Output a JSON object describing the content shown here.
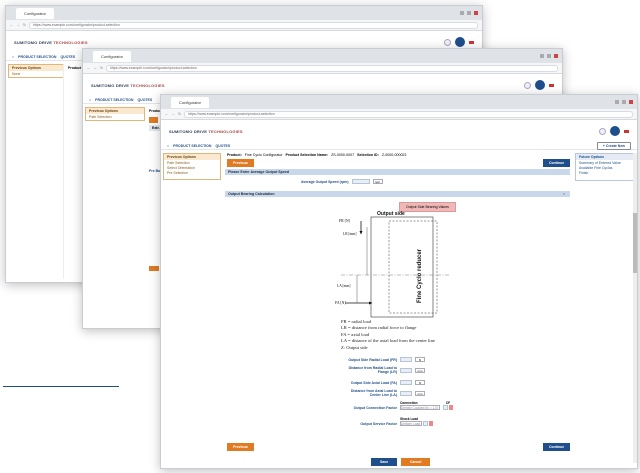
{
  "browser": {
    "tab_label": "Configurator",
    "url": "https://www.example.com/configurator/product-selection"
  },
  "brand": {
    "logo_text": "SUMITOMO DRIVE",
    "logo_suffix": "TECHNOLOGIES"
  },
  "nav": {
    "product_selection": "PRODUCT SELECTION",
    "quotes": "QUOTES",
    "create_new": "+ Create New"
  },
  "win1": {
    "sidebar_title": "Previous Options",
    "sidebar_items": [
      "None"
    ],
    "product_col": "Product"
  },
  "win2": {
    "sidebar_title": "Previous Options",
    "sidebar_items": [
      "Path Selection"
    ],
    "product_col": "Product",
    "ext_label": "Extr. In",
    "prebox": "Pre Ba"
  },
  "main": {
    "product_label": "Product:",
    "product_value": "Fine Cyclo Configurator",
    "selection_name_label": "Product Selection Name:",
    "selection_name_value": "ZS-0000-0007",
    "selection_id_label": "Selection ID:",
    "selection_id_value": "Z-0000-000023",
    "sidebar_title": "Previous Options",
    "sidebar_items": [
      "Path Selection",
      "Select Orientation",
      "Pre Selection"
    ],
    "future_title": "Future Options",
    "future_items": [
      "Summary of Entered Value",
      "Available Fine Cyclos",
      "Finish"
    ],
    "previous_button": "Previous",
    "continue_button": "Continue",
    "section_output_speed": "Please Enter Average Output Speed",
    "avg_speed_label": "Average Output Speed (rpm)",
    "avg_speed_unit": "rpm",
    "section_bearing": "Output Bearing Calculation",
    "bearing_values_button": "Output Side Bearing Values",
    "diagram_title": "Output side",
    "diagram_reducer_label": "Fine Cyclo reducer",
    "diagram_fr": "FR [N]",
    "diagram_lr": "LR [mm]",
    "diagram_la": "LA [mm]",
    "diagram_fa": "FA [N]",
    "legend": [
      "FR = radial load",
      "LR = distance from radial force to flange",
      "FA = axial load",
      "LA = distance of the axial load from the center line",
      "Z:    Output side"
    ],
    "fields": [
      {
        "label": "Output Side Radial Load (FR)",
        "unit": "N"
      },
      {
        "label": "Distance from Radial Load to Flange (LR)",
        "unit": "mm"
      },
      {
        "label": "Output Side Axial Load (FA)",
        "unit": "N"
      },
      {
        "label": "Distance from Axial Load to Center Line (LA)",
        "unit": "mm"
      }
    ],
    "connection_label": "Output Connection Factor",
    "connection_col": "Connection",
    "connection_value": "Directly Coupled (fc = 1.0)",
    "cf_col": "CF",
    "service_label": "Output Service Factor",
    "shock_col": "Shock Load",
    "shock_value": "Uniform Load",
    "previous_bottom": "Previous",
    "continue_bottom": "Continue",
    "save_button": "Save",
    "cancel_button": "Cancel"
  },
  "colors": {
    "accent_blue": "#1f4e8c",
    "accent_orange": "#e07b23",
    "section_bar": "#c8d7ea",
    "pink_button": "#f0b7b7"
  }
}
